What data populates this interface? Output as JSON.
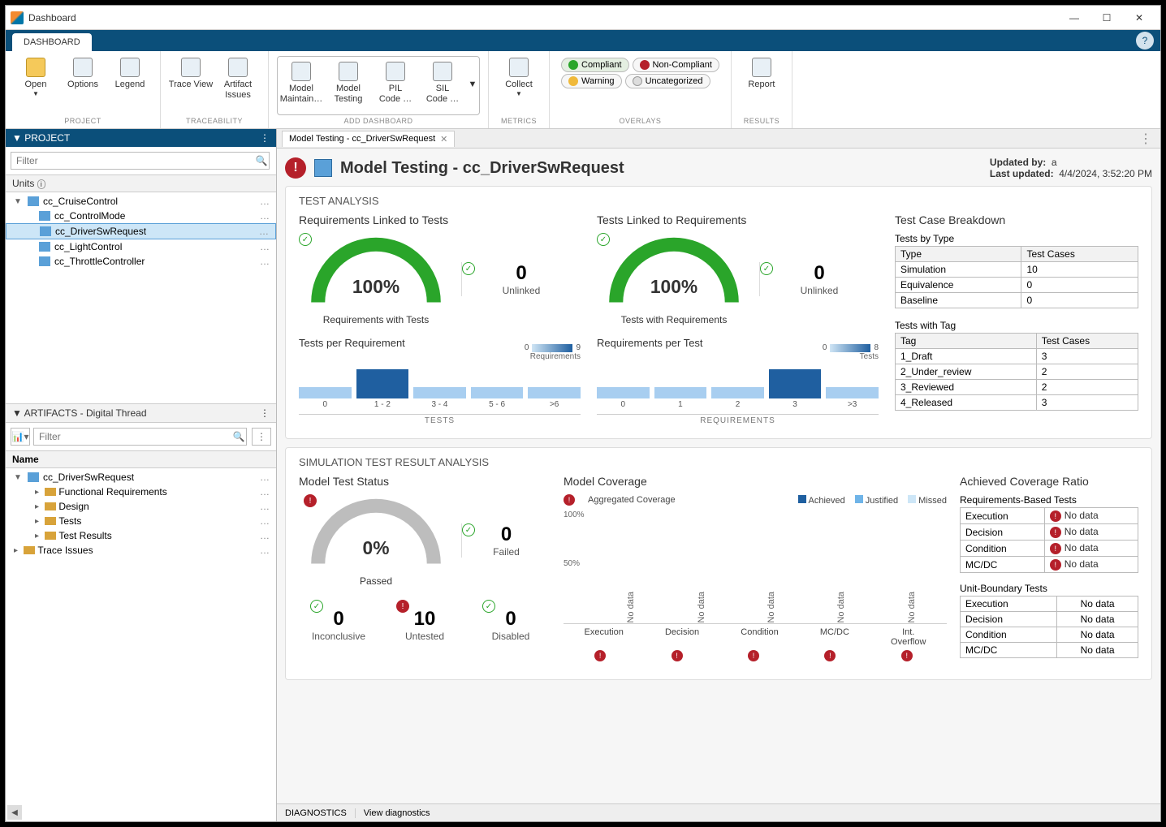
{
  "window": {
    "title": "Dashboard"
  },
  "ribbon": {
    "tab": "DASHBOARD",
    "groups": {
      "project": {
        "label": "PROJECT",
        "open": "Open",
        "options": "Options",
        "legend": "Legend"
      },
      "trace": {
        "label": "TRACEABILITY",
        "traceview": "Trace View",
        "artifact": "Artifact\nIssues"
      },
      "dash": {
        "label": "ADD DASHBOARD",
        "maintain": "Model\nMaintain…",
        "testing": "Model\nTesting",
        "pil": "PIL\nCode …",
        "sil": "SIL\nCode …"
      },
      "metrics": {
        "label": "METRICS",
        "collect": "Collect"
      },
      "overlays": {
        "label": "OVERLAYS",
        "compliant": "Compliant",
        "noncompliant": "Non-Compliant",
        "warning": "Warning",
        "uncat": "Uncategorized"
      },
      "results": {
        "label": "RESULTS",
        "report": "Report"
      }
    }
  },
  "project_panel": {
    "title": "PROJECT",
    "filter_ph": "Filter",
    "units": "Units",
    "root": "cc_CruiseControl",
    "nodes": [
      "cc_ControlMode",
      "cc_DriverSwRequest",
      "cc_LightControl",
      "cc_ThrottleController"
    ],
    "selected": "cc_DriverSwRequest"
  },
  "artifacts": {
    "title": "ARTIFACTS - Digital Thread",
    "filter_ph": "Filter",
    "name_hdr": "Name",
    "root": "cc_DriverSwRequest",
    "children": [
      "Functional Requirements",
      "Design",
      "Tests",
      "Test Results"
    ],
    "trace_issues": "Trace Issues"
  },
  "doc": {
    "tab": "Model Testing - cc_DriverSwRequest"
  },
  "page": {
    "title": "Model Testing - cc_DriverSwRequest",
    "updated_by_lbl": "Updated by:",
    "updated_by": "a",
    "updated_on_lbl": "Last updated:",
    "updated_on": "4/4/2024, 3:52:20 PM"
  },
  "test_analysis": {
    "section": "TEST ANALYSIS",
    "req_linked": {
      "title": "Requirements Linked to Tests",
      "pct": "100%",
      "pct_label": "Requirements with Tests",
      "side_num": "0",
      "side_label": "Unlinked",
      "histo_title": "Tests per Requirement",
      "grad_lo": "0",
      "grad_hi": "9",
      "grad_unit": "Requirements",
      "buckets": [
        "0",
        "1 - 2",
        "3 - 4",
        "5 - 6",
        ">6"
      ],
      "axis": "TESTS"
    },
    "tests_linked": {
      "title": "Tests Linked to Requirements",
      "pct": "100%",
      "pct_label": "Tests with Requirements",
      "side_num": "0",
      "side_label": "Unlinked",
      "histo_title": "Requirements per Test",
      "grad_lo": "0",
      "grad_hi": "8",
      "grad_unit": "Tests",
      "buckets": [
        "0",
        "1",
        "2",
        "3",
        ">3"
      ],
      "axis": "REQUIREMENTS"
    },
    "breakdown": {
      "title": "Test Case Breakdown",
      "by_type_title": "Tests by Type",
      "by_type_cols": [
        "Type",
        "Test Cases"
      ],
      "by_type_rows": [
        [
          "Simulation",
          "10"
        ],
        [
          "Equivalence",
          "0"
        ],
        [
          "Baseline",
          "0"
        ]
      ],
      "with_tag_title": "Tests with Tag",
      "with_tag_cols": [
        "Tag",
        "Test Cases"
      ],
      "with_tag_rows": [
        [
          "1_Draft",
          "3"
        ],
        [
          "2_Under_review",
          "2"
        ],
        [
          "3_Reviewed",
          "2"
        ],
        [
          "4_Released",
          "3"
        ]
      ]
    }
  },
  "sim": {
    "section": "SIMULATION TEST RESULT ANALYSIS",
    "status": {
      "title": "Model Test Status",
      "pct": "0%",
      "pct_label": "Passed",
      "failed_n": "0",
      "failed_l": "Failed",
      "inc_n": "0",
      "inc_l": "Inconclusive",
      "unt_n": "10",
      "unt_l": "Untested",
      "dis_n": "0",
      "dis_l": "Disabled"
    },
    "coverage": {
      "title": "Model Coverage",
      "agg": "Aggregated Coverage",
      "legend": [
        "Achieved",
        "Justified",
        "Missed"
      ],
      "y100": "100%",
      "y50": "50%",
      "cats": [
        "Execution",
        "Decision",
        "Condition",
        "MC/DC",
        "Int.\nOverflow"
      ],
      "nodata": "No data"
    },
    "ratio": {
      "title": "Achieved Coverage Ratio",
      "req_title": "Requirements-Based Tests",
      "unit_title": "Unit-Boundary Tests",
      "cols_rows": [
        "Execution",
        "Decision",
        "Condition",
        "MC/DC"
      ],
      "nodata": "No data"
    }
  },
  "footer": {
    "diag": "DIAGNOSTICS",
    "view": "View diagnostics"
  }
}
